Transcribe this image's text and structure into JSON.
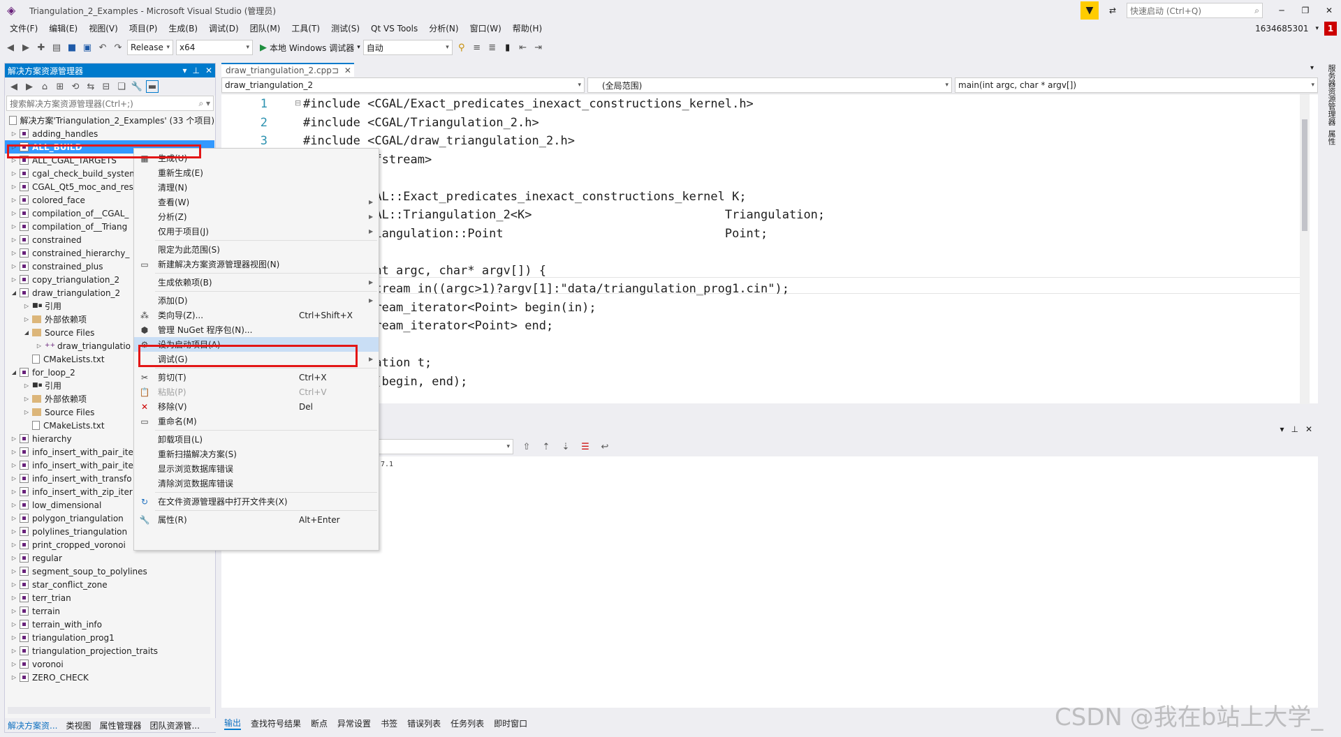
{
  "window": {
    "title": "Triangulation_2_Examples - Microsoft Visual Studio (管理员)",
    "quick_launch_placeholder": "快速启动 (Ctrl+Q)",
    "account": "1634685301",
    "notifications": "1"
  },
  "menu": [
    "文件(F)",
    "编辑(E)",
    "视图(V)",
    "项目(P)",
    "生成(B)",
    "调试(D)",
    "团队(M)",
    "工具(T)",
    "测试(S)",
    "Qt VS Tools",
    "分析(N)",
    "窗口(W)",
    "帮助(H)"
  ],
  "toolbar": {
    "config": "Release",
    "platform": "x64",
    "debugger": "本地 Windows 调试器",
    "mode": "自动"
  },
  "solution_explorer": {
    "title": "解决方案资源管理器",
    "search_placeholder": "搜索解决方案资源管理器(Ctrl+;)",
    "solution_label": "解决方案'Triangulation_2_Examples' (33 个项目)",
    "items": [
      {
        "label": "adding_handles",
        "indent": 0,
        "kind": "proj"
      },
      {
        "label": "ALL_BUILD",
        "indent": 0,
        "kind": "proj",
        "selected": true
      },
      {
        "label": "ALL_CGAL_TARGETS",
        "indent": 0,
        "kind": "proj"
      },
      {
        "label": "cgal_check_build_system",
        "indent": 0,
        "kind": "proj"
      },
      {
        "label": "CGAL_Qt5_moc_and_res",
        "indent": 0,
        "kind": "proj"
      },
      {
        "label": "colored_face",
        "indent": 0,
        "kind": "proj"
      },
      {
        "label": "compilation_of__CGAL_",
        "indent": 0,
        "kind": "proj"
      },
      {
        "label": "compilation_of__Triang",
        "indent": 0,
        "kind": "proj"
      },
      {
        "label": "constrained",
        "indent": 0,
        "kind": "proj"
      },
      {
        "label": "constrained_hierarchy_",
        "indent": 0,
        "kind": "proj"
      },
      {
        "label": "constrained_plus",
        "indent": 0,
        "kind": "proj"
      },
      {
        "label": "copy_triangulation_2",
        "indent": 0,
        "kind": "proj"
      },
      {
        "label": "draw_triangulation_2",
        "indent": 0,
        "kind": "proj",
        "open": true
      },
      {
        "label": "引用",
        "indent": 1,
        "kind": "ref"
      },
      {
        "label": "外部依赖项",
        "indent": 1,
        "kind": "fold"
      },
      {
        "label": "Source Files",
        "indent": 1,
        "kind": "fold",
        "open": true
      },
      {
        "label": "draw_triangulatio",
        "indent": 2,
        "kind": "cpp"
      },
      {
        "label": "CMakeLists.txt",
        "indent": 1,
        "kind": "doc"
      },
      {
        "label": "for_loop_2",
        "indent": 0,
        "kind": "proj",
        "open": true
      },
      {
        "label": "引用",
        "indent": 1,
        "kind": "ref"
      },
      {
        "label": "外部依赖项",
        "indent": 1,
        "kind": "fold"
      },
      {
        "label": "Source Files",
        "indent": 1,
        "kind": "fold"
      },
      {
        "label": "CMakeLists.txt",
        "indent": 1,
        "kind": "doc"
      },
      {
        "label": "hierarchy",
        "indent": 0,
        "kind": "proj"
      },
      {
        "label": "info_insert_with_pair_ite",
        "indent": 0,
        "kind": "proj"
      },
      {
        "label": "info_insert_with_pair_ite",
        "indent": 0,
        "kind": "proj"
      },
      {
        "label": "info_insert_with_transfo",
        "indent": 0,
        "kind": "proj"
      },
      {
        "label": "info_insert_with_zip_iter",
        "indent": 0,
        "kind": "proj"
      },
      {
        "label": "low_dimensional",
        "indent": 0,
        "kind": "proj"
      },
      {
        "label": "polygon_triangulation",
        "indent": 0,
        "kind": "proj"
      },
      {
        "label": "polylines_triangulation",
        "indent": 0,
        "kind": "proj"
      },
      {
        "label": "print_cropped_voronoi",
        "indent": 0,
        "kind": "proj"
      },
      {
        "label": "regular",
        "indent": 0,
        "kind": "proj"
      },
      {
        "label": "segment_soup_to_polylines",
        "indent": 0,
        "kind": "proj"
      },
      {
        "label": "star_conflict_zone",
        "indent": 0,
        "kind": "proj"
      },
      {
        "label": "terr_trian",
        "indent": 0,
        "kind": "proj"
      },
      {
        "label": "terrain",
        "indent": 0,
        "kind": "proj"
      },
      {
        "label": "terrain_with_info",
        "indent": 0,
        "kind": "proj"
      },
      {
        "label": "triangulation_prog1",
        "indent": 0,
        "kind": "proj"
      },
      {
        "label": "triangulation_projection_traits",
        "indent": 0,
        "kind": "proj"
      },
      {
        "label": "voronoi",
        "indent": 0,
        "kind": "proj"
      },
      {
        "label": "ZERO_CHECK",
        "indent": 0,
        "kind": "proj"
      }
    ],
    "tabs": [
      "解决方案资...",
      "类视图",
      "属性管理器",
      "团队资源管..."
    ]
  },
  "editor": {
    "tab_label": "draw_triangulation_2.cpp",
    "nav_project": "draw_triangulation_2",
    "nav_scope": "(全局范围)",
    "nav_func": "main(int argc, char * argv[])",
    "lines": [
      {
        "n": "1",
        "code": "#include <CGAL/Exact_predicates_inexact_constructions_kernel.h>"
      },
      {
        "n": "2",
        "code": "#include <CGAL/Triangulation_2.h>"
      },
      {
        "n": "3",
        "code": "#include <CGAL/draw_triangulation_2.h>"
      },
      {
        "n": "",
        "code": "         <fstream>"
      },
      {
        "n": "",
        "code": ""
      },
      {
        "n": "",
        "code": "         GAL::Exact_predicates_inexact_constructions_kernel K;"
      },
      {
        "n": "",
        "code": "         GAL::Triangulation_2<K>                           Triangulation;"
      },
      {
        "n": "",
        "code": "         riangulation::Point                               Point;"
      },
      {
        "n": "",
        "code": ""
      },
      {
        "n": "",
        "code": "         int argc, char* argv[]) {"
      },
      {
        "n": "",
        "code": "         stream in((argc>1)?argv[1]:\"data/triangulation_prog1.cin\");"
      },
      {
        "n": "",
        "code": "         tream_iterator<Point> begin(in);"
      },
      {
        "n": "",
        "code": "         tream_iterator<Point> end;"
      },
      {
        "n": "",
        "code": ""
      },
      {
        "n": "",
        "code": "         lation t;"
      },
      {
        "n": "",
        "code": "         t(begin, end);"
      }
    ]
  },
  "output": {
    "text": "7.1"
  },
  "bottom_tabs": [
    "输出",
    "查找符号结果",
    "断点",
    "异常设置",
    "书签",
    "错误列表",
    "任务列表",
    "即时窗口"
  ],
  "right_strip": [
    "服务器资源管理器",
    "属性"
  ],
  "context_menu": [
    {
      "label": "生成(U)",
      "shortcut": "",
      "icon": "build-icon",
      "sub": false
    },
    {
      "label": "重新生成(E)",
      "shortcut": "",
      "icon": "",
      "sub": false
    },
    {
      "label": "清理(N)",
      "shortcut": "",
      "icon": "",
      "sub": false
    },
    {
      "label": "查看(W)",
      "shortcut": "",
      "icon": "",
      "sub": true
    },
    {
      "label": "分析(Z)",
      "shortcut": "",
      "icon": "",
      "sub": true
    },
    {
      "label": "仅用于项目(J)",
      "shortcut": "",
      "icon": "",
      "sub": true
    },
    {
      "sep": true
    },
    {
      "label": "限定为此范围(S)",
      "shortcut": "",
      "icon": "",
      "sub": false
    },
    {
      "label": "新建解决方案资源管理器视图(N)",
      "shortcut": "",
      "icon": "new-view-icon",
      "sub": false
    },
    {
      "sep": true
    },
    {
      "label": "生成依赖项(B)",
      "shortcut": "",
      "icon": "",
      "sub": true
    },
    {
      "sep": true
    },
    {
      "label": "添加(D)",
      "shortcut": "",
      "icon": "",
      "sub": true
    },
    {
      "label": "类向导(Z)...",
      "shortcut": "Ctrl+Shift+X",
      "icon": "class-wizard-icon",
      "sub": false
    },
    {
      "label": "管理 NuGet 程序包(N)...",
      "shortcut": "",
      "icon": "nuget-icon",
      "sub": false
    },
    {
      "label": "设为启动项目(A)",
      "shortcut": "",
      "icon": "gear-icon",
      "sub": false,
      "highlight": true
    },
    {
      "label": "调试(G)",
      "shortcut": "",
      "icon": "",
      "sub": true
    },
    {
      "sep": true
    },
    {
      "label": "剪切(T)",
      "shortcut": "Ctrl+X",
      "icon": "scissors-icon",
      "sub": false
    },
    {
      "label": "粘贴(P)",
      "shortcut": "Ctrl+V",
      "icon": "paste-icon",
      "sub": false,
      "disabled": true
    },
    {
      "label": "移除(V)",
      "shortcut": "Del",
      "icon": "remove-icon",
      "sub": false
    },
    {
      "label": "重命名(M)",
      "shortcut": "",
      "icon": "rename-icon",
      "sub": false
    },
    {
      "sep": true
    },
    {
      "label": "卸载项目(L)",
      "shortcut": "",
      "icon": "",
      "sub": false
    },
    {
      "label": "重新扫描解决方案(S)",
      "shortcut": "",
      "icon": "",
      "sub": false
    },
    {
      "label": "显示浏览数据库错误",
      "shortcut": "",
      "icon": "",
      "sub": false
    },
    {
      "label": "清除浏览数据库错误",
      "shortcut": "",
      "icon": "",
      "sub": false
    },
    {
      "sep": true
    },
    {
      "label": "在文件资源管理器中打开文件夹(X)",
      "shortcut": "",
      "icon": "refresh-icon",
      "sub": false
    },
    {
      "sep": true
    },
    {
      "label": "属性(R)",
      "shortcut": "Alt+Enter",
      "icon": "wrench-icon",
      "sub": false
    }
  ],
  "watermark": "CSDN @我在b站上大学_"
}
